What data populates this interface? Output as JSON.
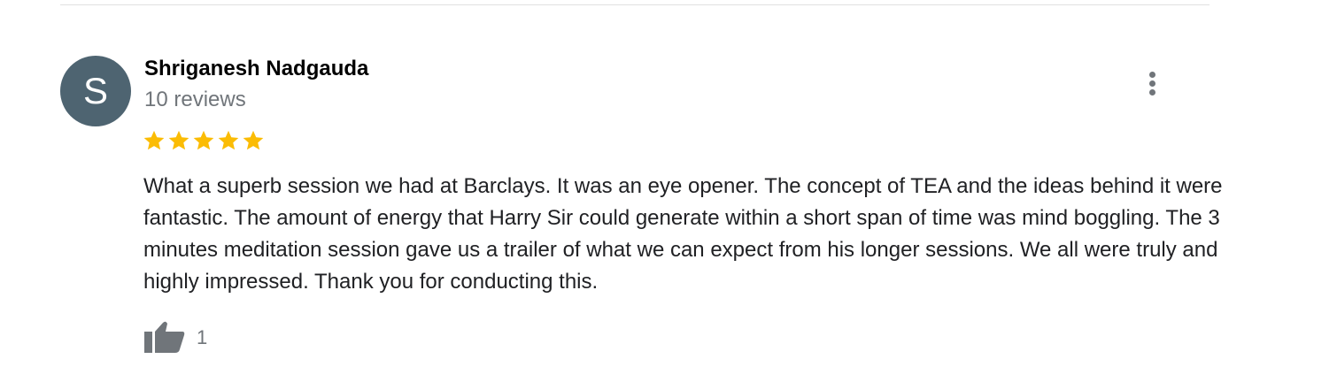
{
  "review": {
    "avatar_letter": "S",
    "reviewer_name": "Shriganesh Nadgauda",
    "review_count": "10 reviews",
    "rating": 5,
    "rating_max": 5,
    "star_color": "#fbbc04",
    "text": "What a superb session we had at Barclays.  It was an eye opener.  The concept of TEA and the ideas behind it were fantastic.  The amount of energy that Harry Sir could generate within a short span of time was mind boggling.  The 3 minutes meditation session gave us a trailer of what we can expect from his longer sessions.  We all were truly and highly impressed.  Thank you for conducting this.",
    "likes": "1"
  },
  "icons": {
    "more": "more-vert-icon",
    "like": "thumbs-up-icon",
    "star": "star-icon"
  },
  "colors": {
    "avatar_bg": "#4e6471",
    "secondary_text": "#70757a"
  }
}
